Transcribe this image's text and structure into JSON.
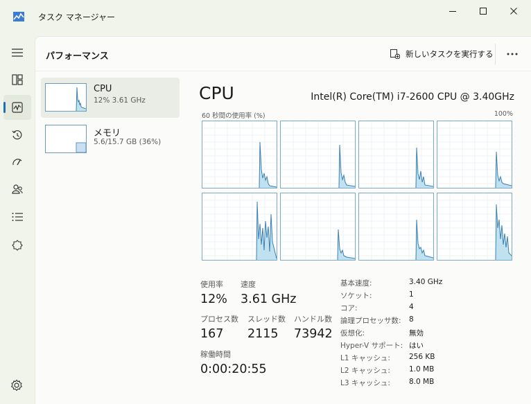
{
  "window": {
    "title": "タスク マネージャー"
  },
  "header": {
    "title": "パフォーマンス",
    "run_task_label": "新しいタスクを実行する"
  },
  "sidebar": {
    "items": [
      {
        "name": "CPU",
        "detail": "12%  3.61 GHz"
      },
      {
        "name": "メモリ",
        "detail": "5.6/15.7 GB (36%)"
      }
    ]
  },
  "panel": {
    "title": "CPU",
    "model": "Intel(R) Core(TM) i7-2600 CPU @ 3.40GHz",
    "graph_caption": "60 秒間の使用率 (%)",
    "graph_max": "100%"
  },
  "stats": {
    "usage_label": "使用率",
    "usage_value": "12%",
    "speed_label": "速度",
    "speed_value": "3.61 GHz",
    "processes_label": "プロセス数",
    "processes_value": "167",
    "threads_label": "スレッド数",
    "threads_value": "2115",
    "handles_label": "ハンドル数",
    "handles_value": "73942",
    "uptime_label": "稼働時間",
    "uptime_value": "0:00:20:55"
  },
  "specs": [
    {
      "key": "基本速度:",
      "value": "3.40 GHz"
    },
    {
      "key": "ソケット:",
      "value": "1"
    },
    {
      "key": "コア:",
      "value": "4"
    },
    {
      "key": "論理プロセッサ数:",
      "value": "8"
    },
    {
      "key": "仮想化:",
      "value": "無効"
    },
    {
      "key": "Hyper-V サポート:",
      "value": "はい"
    },
    {
      "key": "L1 キャッシュ:",
      "value": "256 KB"
    },
    {
      "key": "L2 キャッシュ:",
      "value": "1.0 MB"
    },
    {
      "key": "L3 キャッシュ:",
      "value": "8.0 MB"
    }
  ],
  "icons": {
    "menu": "hamburger-icon",
    "processes": "processes-icon",
    "performance": "performance-icon",
    "history": "app-history-icon",
    "startup": "startup-apps-icon",
    "users": "users-icon",
    "details": "details-icon",
    "services": "services-icon",
    "settings": "gear-icon"
  },
  "colors": {
    "accent": "#1f6fb5",
    "graph_line": "#3b7fb0",
    "graph_fill": "#bfe1f0"
  }
}
